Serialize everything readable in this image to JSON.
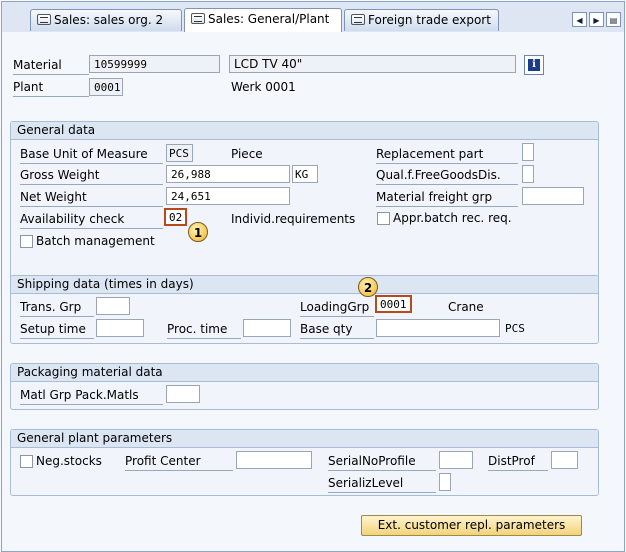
{
  "tabs": [
    {
      "label": "Sales: sales org. 2"
    },
    {
      "label": "Sales: General/Plant"
    },
    {
      "label": "Foreign trade export"
    }
  ],
  "header": {
    "material_label": "Material",
    "material_value": "10599999",
    "material_desc": "LCD TV 40\"",
    "plant_label": "Plant",
    "plant_value": "0001",
    "plant_name": "Werk 0001"
  },
  "general_data": {
    "title": "General data",
    "base_uom_label": "Base Unit of Measure",
    "base_uom_value": "PCS",
    "base_uom_text": "Piece",
    "gross_weight_label": "Gross Weight",
    "gross_weight_value": "26,988",
    "weight_unit": "KG",
    "net_weight_label": "Net Weight",
    "net_weight_value": "24,651",
    "availability_label": "Availability check",
    "availability_value": "02",
    "availability_text": "Individ.requirements",
    "batch_mgmt_label": "Batch management",
    "replacement_label": "Replacement part",
    "qual_free_label": "Qual.f.FreeGoodsDis.",
    "freight_grp_label": "Material freight grp",
    "appr_batch_label": "Appr.batch rec. req."
  },
  "shipping": {
    "title": "Shipping data (times in days)",
    "trans_grp_label": "Trans. Grp",
    "loading_grp_label": "LoadingGrp",
    "loading_grp_value": "0001",
    "loading_grp_text": "Crane",
    "setup_time_label": "Setup time",
    "proc_time_label": "Proc. time",
    "base_qty_label": "Base qty",
    "base_qty_unit": "PCS"
  },
  "packaging": {
    "title": "Packaging material data",
    "matl_grp_label": "Matl Grp Pack.Matls"
  },
  "plant_params": {
    "title": "General plant parameters",
    "neg_stocks_label": "Neg.stocks",
    "profit_center_label": "Profit Center",
    "serial_profile_label": "SerialNoProfile",
    "distprof_label": "DistProf",
    "serializ_level_label": "SerializLevel"
  },
  "buttons": {
    "ext_customer": "Ext. customer repl. parameters"
  },
  "annotations": [
    "1",
    "2"
  ]
}
